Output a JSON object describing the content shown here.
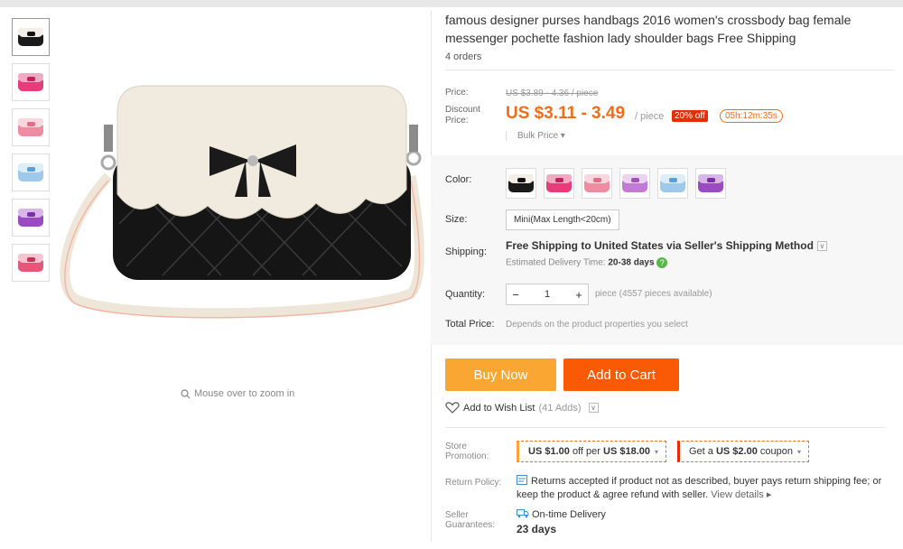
{
  "product": {
    "title": "famous designer purses handbags 2016 women's crossbody bag female messenger pochette fashion lady shoulder bags Free Shipping",
    "orders": "4 orders"
  },
  "gallery": {
    "zoom_hint": "Mouse over to zoom in",
    "thumbnails": [
      {
        "body": "#1a1a1a",
        "bow": "#111"
      },
      {
        "body": "#e63d7a",
        "bow": "#c81d5f"
      },
      {
        "body": "#f08ca2",
        "bow": "#e06d84"
      },
      {
        "body": "#9ec9ea",
        "bow": "#5e9fd3"
      },
      {
        "body": "#9a4bc1",
        "bow": "#7b2fa6"
      },
      {
        "body": "#e8557a",
        "bow": "#c9345b"
      }
    ]
  },
  "pricing": {
    "price_label": "Price:",
    "old_price": "US $3.89 - 4.36 / piece",
    "discount_label": "Discount Price:",
    "discount_price": "US $3.11 - 3.49",
    "per_unit": "/ piece",
    "discount_pct": "20% off",
    "countdown": "05h:12m:35s",
    "bulk": "Bulk Price"
  },
  "options": {
    "color_label": "Color:",
    "size_label": "Size:",
    "size_value": "Mini(Max Length<20cm)",
    "shipping_label": "Shipping:",
    "shipping_value": "Free Shipping to United States via Seller's Shipping Method",
    "delivery_prefix": "Estimated Delivery Time:",
    "delivery_days": "20-38 days",
    "quantity_label": "Quantity:",
    "quantity_value": "1",
    "available": "piece (4557 pieces available)",
    "total_label": "Total Price:",
    "total_note": "Depends on the product properties you select"
  },
  "actions": {
    "buy_now": "Buy Now",
    "add_to_cart": "Add to Cart",
    "wishlist": "Add to Wish List",
    "wish_count": "(41 Adds)"
  },
  "promo": {
    "store_label": "Store Promotion:",
    "coupon1_prefix": "US $1.00",
    "coupon1_mid": "off per",
    "coupon1_suffix": "US $18.00",
    "coupon2_prefix": "Get a",
    "coupon2_amount": "US $2.00",
    "coupon2_suffix": "coupon",
    "return_label": "Return Policy:",
    "return_text": "Returns accepted if product not as described, buyer pays return shipping fee; or keep the product & agree refund with seller.",
    "view_details": "View details",
    "guarantee_label": "Seller Guarantees:",
    "guarantee_title": "On-time Delivery",
    "guarantee_days": "23 days"
  },
  "colors": {
    "accent_orange": "#f86b15",
    "buy_now": "#f9a732",
    "add_to_cart": "#fa5a04",
    "badge_red": "#e62e04"
  }
}
